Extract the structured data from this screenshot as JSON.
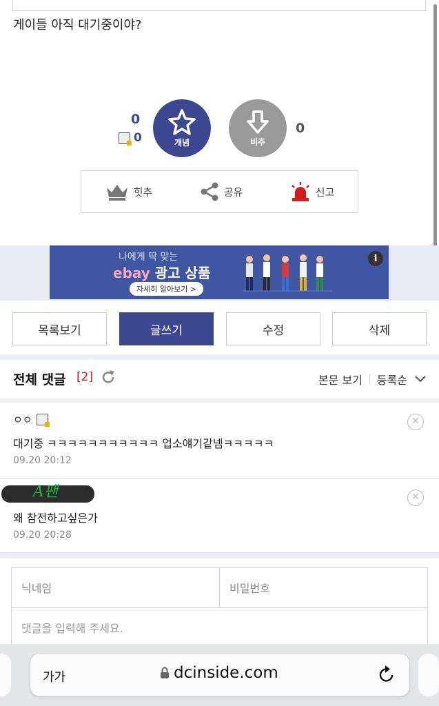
{
  "post": {
    "body": "게이들 아직 대기중이야?"
  },
  "vote": {
    "up_count": "0",
    "fix_count": "0",
    "down_count": "0",
    "up_label": "개념",
    "down_label": "비추",
    "up_color": "#3b4890",
    "down_color": "#9a9a9a"
  },
  "actions": {
    "best": "힛추",
    "share": "공유",
    "report": "신고"
  },
  "ad": {
    "line1": "나에게 딱 맞는",
    "brand": "ebay",
    "headline": "광고 상품",
    "cta": "자세히 알아보기 >",
    "info": "i"
  },
  "buttons": {
    "list": "목록보기",
    "write": "글쓰기",
    "edit": "수정",
    "delete": "삭제"
  },
  "comments_header": {
    "title": "전체 댓글",
    "count": "[2]",
    "view_body": "본문 보기",
    "sort": "등록순"
  },
  "comments": [
    {
      "nick": "ㅇㅇ",
      "text": "대기중 ㅋㅋㅋㅋㅋㅋㅋㅋㅋㅋㅋ 업소얘기같넴ㅋㅋㅋㅋㅋ",
      "date": "09.20 20:12"
    },
    {
      "nick": "A팬",
      "text": "왜 참전하고싶은가",
      "date": "09.20 20:28"
    }
  ],
  "form": {
    "nickname_placeholder": "닉네임",
    "password_placeholder": "비밀번호",
    "comment_placeholder": "댓글을 입력해 주세요."
  },
  "browser": {
    "text_size": "가가",
    "url": "dcinside.com"
  }
}
